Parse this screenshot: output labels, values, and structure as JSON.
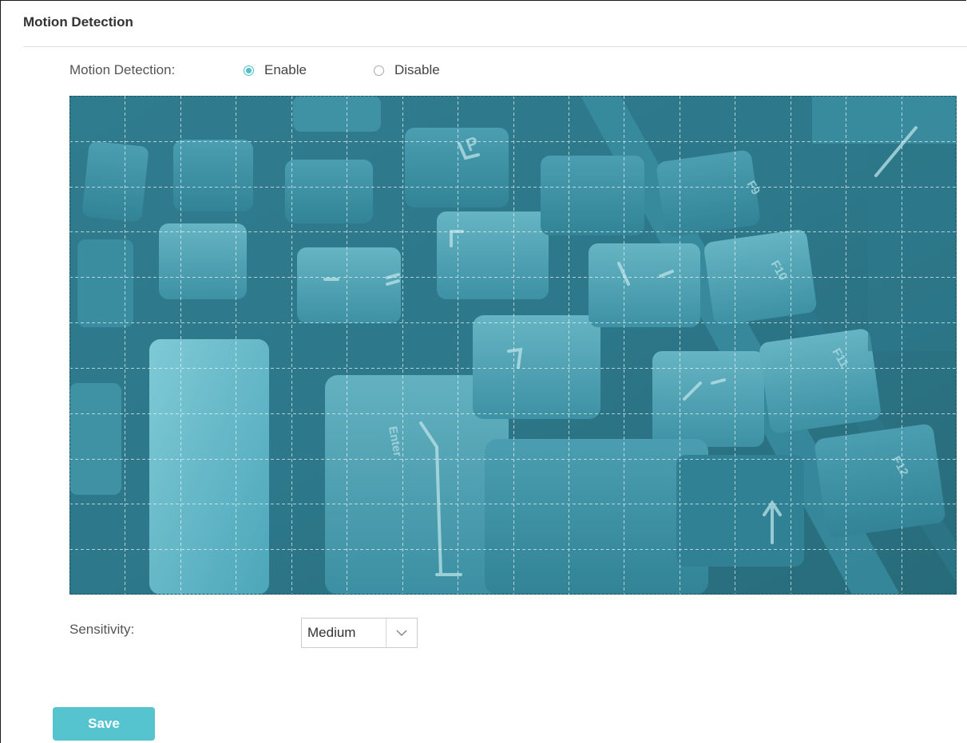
{
  "section": {
    "title": "Motion Detection"
  },
  "motion_detection": {
    "label": "Motion Detection:",
    "options": [
      {
        "label": "Enable",
        "selected": true
      },
      {
        "label": "Disable",
        "selected": false
      }
    ]
  },
  "video_preview": {
    "grid_columns": 16,
    "grid_rows": 11,
    "overlay_color": "#3f9fb3",
    "key_labels": [
      "P",
      "F9",
      "F10",
      "F11",
      "F12",
      "Enter"
    ]
  },
  "sensitivity": {
    "label": "Sensitivity:",
    "value": "Medium",
    "arrow_icon": "chevron-down-icon"
  },
  "actions": {
    "save_label": "Save"
  },
  "colors": {
    "accent": "#4fbfcb",
    "button": "#56c4cf",
    "radio_checked": "#4fbfcb"
  }
}
